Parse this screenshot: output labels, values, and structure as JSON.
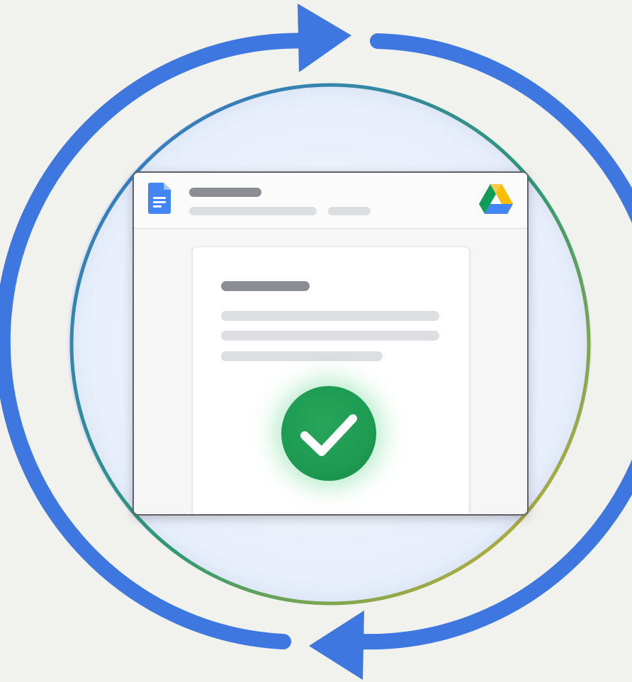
{
  "scene": {
    "description_icons": [
      "sync-loop-icon",
      "google-docs-icon",
      "google-drive-icon",
      "checkmark-icon"
    ],
    "colors": {
      "background": "#f1f1ee",
      "arrow_blue": "#3e77e0",
      "ring_gradient_start": "#3a73db",
      "ring_gradient_mid": "#2f9a6f",
      "ring_gradient_end": "#e2b42a",
      "docs_blue": "#4285f4",
      "check_green": "#1e9b52",
      "skeleton_dark": "#8a8e94",
      "skeleton_light": "#dcdee1"
    },
    "window": {
      "title_text": "",
      "subtitle_text": ""
    },
    "status": {
      "synced": true
    }
  }
}
